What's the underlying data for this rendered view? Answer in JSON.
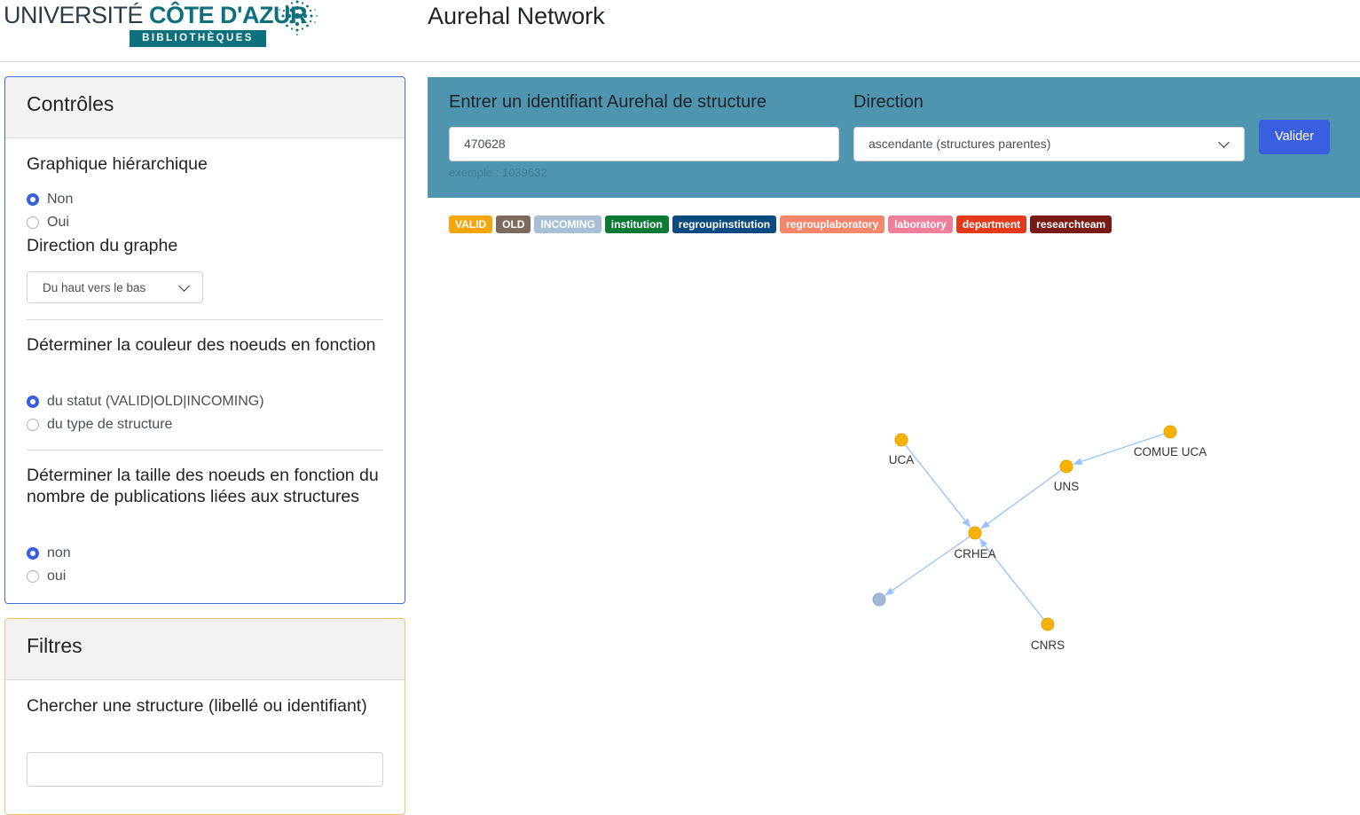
{
  "header": {
    "logo": {
      "university": "UNIVERSITÉ",
      "brand": "CÔTE D'AZUR",
      "subtitle": "BIBLIOTHÈQUES"
    },
    "app_title": "Aurehal Network"
  },
  "controls": {
    "title": "Contrôles",
    "hierarchical": {
      "title": "Graphique hiérarchique",
      "options": [
        "Non",
        "Oui"
      ],
      "selected": "Non"
    },
    "graph_direction": {
      "title": "Direction du graphe",
      "value": "Du haut vers le bas"
    },
    "node_color": {
      "title": "Déterminer la couleur des noeuds en fonction",
      "options": [
        "du statut (VALID|OLD|INCOMING)",
        "du type de structure"
      ],
      "selected": "du statut (VALID|OLD|INCOMING)"
    },
    "node_size": {
      "title": "Déterminer la taille des noeuds en fonction du nombre de publications liées aux structures",
      "options": [
        "non",
        "oui"
      ],
      "selected": "non"
    }
  },
  "filters": {
    "title": "Filtres",
    "search_label": "Chercher une structure (libellé ou identifiant)",
    "search_value": ""
  },
  "query": {
    "id_label": "Entrer un identifiant Aurehal de structure",
    "id_value": "470628",
    "id_hint": "exemple : 1039632",
    "direction_label": "Direction",
    "direction_value": "ascendante (structures parentes)",
    "submit_label": "Valider"
  },
  "legend": [
    {
      "label": "VALID",
      "color": "#f5a60c"
    },
    {
      "label": "OLD",
      "color": "#7b6a5e"
    },
    {
      "label": "INCOMING",
      "color": "#a8bfd6"
    },
    {
      "label": "institution",
      "color": "#0b7a35"
    },
    {
      "label": "regroupinstitution",
      "color": "#0c4a80"
    },
    {
      "label": "regrouplaboratory",
      "color": "#f5866c"
    },
    {
      "label": "laboratory",
      "color": "#f17f9c"
    },
    {
      "label": "department",
      "color": "#e23a1a"
    },
    {
      "label": "researchteam",
      "color": "#7a1a14"
    }
  ],
  "graph": {
    "node_colors": {
      "valid": "#f8b203",
      "incoming": "#a3b8d2",
      "edge": "#97c2fc"
    },
    "nodes": [
      {
        "id": "UCA",
        "label": "UCA",
        "status": "valid"
      },
      {
        "id": "COMUE_UCA",
        "label": "COMUE UCA",
        "status": "valid"
      },
      {
        "id": "UNS",
        "label": "UNS",
        "status": "valid"
      },
      {
        "id": "CRHEA",
        "label": "CRHEA",
        "status": "valid"
      },
      {
        "id": "UNNAMED",
        "label": "",
        "status": "incoming"
      },
      {
        "id": "CNRS",
        "label": "CNRS",
        "status": "valid"
      }
    ],
    "edges": [
      {
        "from": "UCA",
        "to": "CRHEA"
      },
      {
        "from": "COMUE_UCA",
        "to": "UNS"
      },
      {
        "from": "UNS",
        "to": "CRHEA"
      },
      {
        "from": "CNRS",
        "to": "CRHEA"
      },
      {
        "from": "CRHEA",
        "to": "UNNAMED"
      }
    ]
  }
}
